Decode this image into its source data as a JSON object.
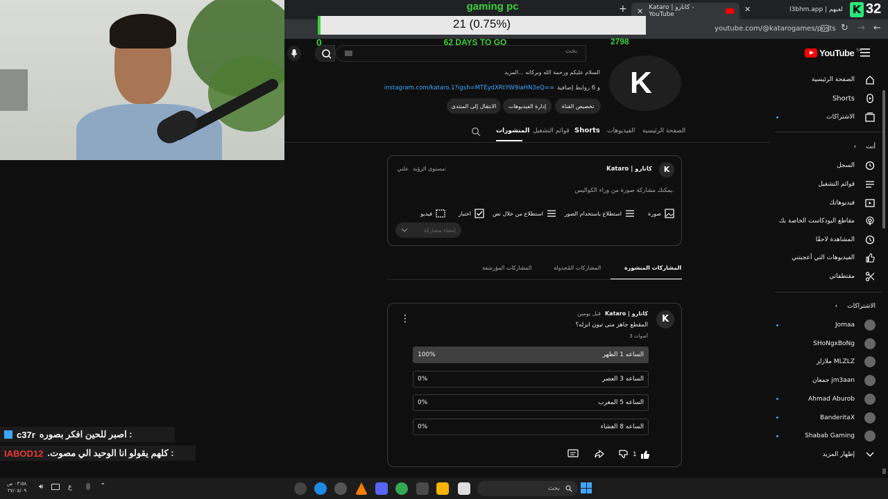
{
  "stream": {
    "goal_title": "gaming pc",
    "goal_progress_text": "21 (0.75%)",
    "goal_progress_fraction": 0.0075,
    "goal_min": "0",
    "goal_days": "62 DAYS TO GO",
    "goal_max": "2798",
    "chat": [
      {
        "user": "c37r",
        "message": "اصبر للحين افكر بصوره :",
        "user_color": "#ffffff"
      },
      {
        "user": "IABOD12",
        "message": ".كلهم يقولو انا الوحيد الي مصوت :",
        "user_color": "#e53935"
      }
    ]
  },
  "browser": {
    "tabs": [
      {
        "label": "l3bhm.app | لعبهم",
        "active": false
      },
      {
        "label": "Kataro | كاتارو - YouTube",
        "active": true
      }
    ],
    "url": "youtube.com/@katarogames/posts",
    "brand_badge": "32"
  },
  "header": {
    "logo": "YouTube",
    "region": "SA",
    "search_placeholder": "بحث"
  },
  "sidebar": {
    "main": [
      {
        "label": "الصفحة الرئيسية",
        "icon": "home-icon"
      },
      {
        "label": "Shorts",
        "icon": "shorts-icon"
      },
      {
        "label": "الاشتراكات",
        "icon": "subscriptions-icon"
      }
    ],
    "you_label": "أنت",
    "you": [
      {
        "label": "السجل",
        "icon": "history-icon"
      },
      {
        "label": "قوائم التشغيل",
        "icon": "playlists-icon"
      },
      {
        "label": "فيديوهاتك",
        "icon": "your-videos-icon"
      },
      {
        "label": "مقاطع البودكاست الخاصة بك",
        "icon": "podcast-icon"
      },
      {
        "label": "المشاهدة لاحقًا",
        "icon": "clock-icon"
      },
      {
        "label": "الفيديوهات التي أعجبتني",
        "icon": "like-icon"
      },
      {
        "label": "مقتطفاتي",
        "icon": "scissors-icon"
      }
    ],
    "subs_label": "الاشتراكات",
    "subs": [
      {
        "name": "Jomaa",
        "dot": true
      },
      {
        "name": "SHoNgxBoNg",
        "dot": false
      },
      {
        "name": "ملازلز MLZLZ",
        "dot": false
      },
      {
        "name": "جمعان jm3aan",
        "dot": false
      },
      {
        "name": "Ahmad Aburob",
        "dot": true
      },
      {
        "name": "BanderitaX",
        "dot": true
      },
      {
        "name": "Shabab Gaming",
        "dot": true
      }
    ],
    "show_more": "إظهار المزيد"
  },
  "channel": {
    "description": "السلام عليكم ورحمة الله وبركاته ...المزيد",
    "link_text": "instagram.com/kataro.1?igsh=MTEydXRtYW9iaHN3eQ==",
    "link_suffix": "و 6 روابط إضافية",
    "buttons": [
      "تخصيص القناة",
      "إدارة الفيديوهات",
      "الانتقال إلى المنتدى"
    ],
    "tabs": [
      "الصفحة الرئيسية",
      "الفيديوهات",
      "Shorts",
      "قوائم التشغيل",
      "المنشورات"
    ],
    "active_tab": "المنشورات"
  },
  "composer": {
    "author": "Kataro | كاتارو",
    "visibility_label": "مستوى الرؤية:",
    "visibility_value": "علني",
    "prompt": "يمكنك مشاركة صورة من وراء الكواليس.",
    "actions": [
      {
        "label": "صورة",
        "icon": "image-icon"
      },
      {
        "label": "استطلاع باستخدام الصور",
        "icon": "image-poll-icon"
      },
      {
        "label": "استطلاع من خلال نص",
        "icon": "text-poll-icon"
      },
      {
        "label": "اختبار",
        "icon": "quiz-icon"
      },
      {
        "label": "فيديو",
        "icon": "video-icon"
      }
    ],
    "submit_label": "إنشاء مشاركة"
  },
  "post_tabs": {
    "items": [
      "المشاركات المنشورة",
      "المشاركات المُجدولة",
      "المشاركات المؤرشفة"
    ],
    "active": "المشاركات المنشورة"
  },
  "post": {
    "author": "Kataro | كاتارو",
    "time": "قبل يومين",
    "question": "المقطع جاهز متى تبون انزله؟",
    "votes": "3 أصوات",
    "options": [
      {
        "label": "الساعه 1 الظهر",
        "percent": "100%",
        "value": 1.0
      },
      {
        "label": "الساعه 3 العصر",
        "percent": "0%",
        "value": 0
      },
      {
        "label": "الساعه 5 المغرب",
        "percent": "0%",
        "value": 0
      },
      {
        "label": "الساعه 8 العشاء",
        "percent": "0%",
        "value": 0
      }
    ],
    "likes": "1"
  },
  "taskbar": {
    "search_placeholder": "بحث",
    "time": "٠٣:٥٨ ص",
    "date": "٢٧/٠٥/٠٩",
    "lang": "ع"
  }
}
